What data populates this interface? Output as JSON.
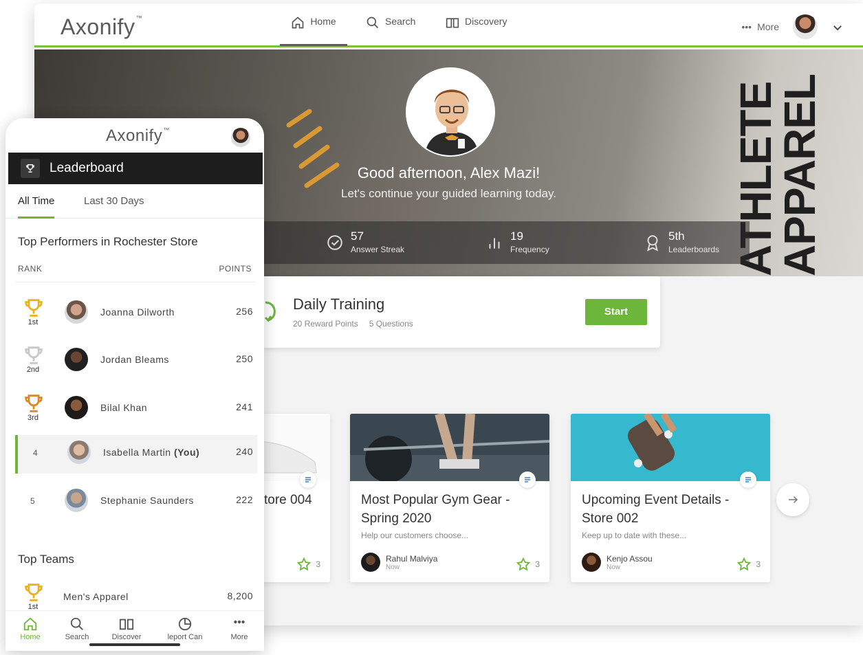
{
  "brand": {
    "name": "Axonify",
    "tm": "™"
  },
  "desktop": {
    "nav": {
      "home": "Home",
      "search": "Search",
      "discovery": "Discovery",
      "more": "More"
    },
    "hero": {
      "greeting": "Good afternoon, Alex Mazi!",
      "subtitle": "Let's continue your guided learning today.",
      "backdrop_text": "ATHLETE APPAREL"
    },
    "stats": [
      {
        "value": "57",
        "label": "Answer Streak",
        "icon": "check-circle-icon"
      },
      {
        "value": "19",
        "label": "Frequency",
        "icon": "bar-chart-icon"
      },
      {
        "value": "5th",
        "label": "Leaderboards",
        "icon": "ribbon-icon"
      }
    ],
    "training": {
      "title": "Daily Training",
      "reward": "20 Reward Points",
      "questions": "5 Questions",
      "start_label": "Start"
    },
    "cards": [
      {
        "title": "tore 004",
        "desc": "",
        "author": "",
        "time": "",
        "favs": "3"
      },
      {
        "title": "Most Popular Gym Gear - Spring 2020",
        "desc": "Help our customers choose...",
        "author": "Rahul Malviya",
        "time": "Now",
        "favs": "3"
      },
      {
        "title": "Upcoming Event Details - Store 002",
        "desc": "Keep up to date with these...",
        "author": "Kenjo Assou",
        "time": "Now",
        "favs": "3"
      }
    ]
  },
  "phone": {
    "header": "Leaderboard",
    "tabs": [
      "All Time",
      "Last 30 Days"
    ],
    "performers_title": "Top Performers in Rochester Store",
    "col_rank": "RANK",
    "col_points": "POINTS",
    "rows": [
      {
        "rank": "1st",
        "trophy": "gold",
        "name": "Joanna Dilworth",
        "you": "",
        "points": "256"
      },
      {
        "rank": "2nd",
        "trophy": "silver",
        "name": "Jordan Bleams",
        "you": "",
        "points": "250"
      },
      {
        "rank": "3rd",
        "trophy": "bronze",
        "name": "Bilal Khan",
        "you": "",
        "points": "241"
      },
      {
        "rank": "4",
        "trophy": "",
        "name": "Isabella Martin",
        "you": "(You)",
        "points": "240"
      },
      {
        "rank": "5",
        "trophy": "",
        "name": "Stephanie Saunders",
        "you": "",
        "points": "222"
      }
    ],
    "teams_title": "Top Teams",
    "team_row": {
      "rank": "1st",
      "name": "Men's Apparel",
      "points": "8,200"
    },
    "bottom_nav": [
      "Home",
      "Search",
      "Discover",
      "leport Can",
      "More"
    ]
  },
  "colors": {
    "accent": "#6bb63b",
    "gold": "#e5b325",
    "silver": "#c8c8c8",
    "bronze": "#d88a2a",
    "dark": "#1d1d1d"
  }
}
